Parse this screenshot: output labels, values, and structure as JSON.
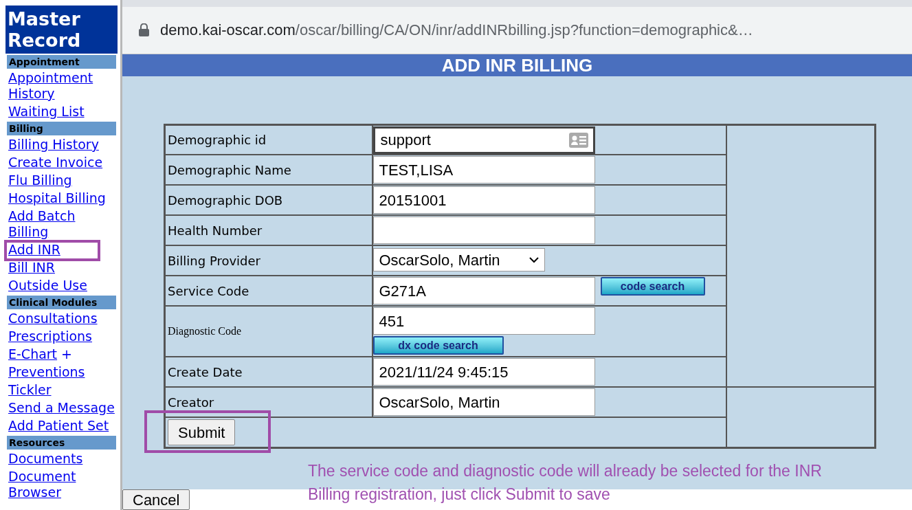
{
  "sidebar": {
    "title": "Master Record",
    "sections": [
      {
        "heading": "Appointment",
        "links": [
          {
            "label": "Appointment History",
            "highlighted": false
          },
          {
            "label": "Waiting List",
            "highlighted": false
          }
        ]
      },
      {
        "heading": "Billing",
        "links": [
          {
            "label": "Billing History",
            "highlighted": false
          },
          {
            "label": "Create Invoice",
            "highlighted": false
          },
          {
            "label": "Flu Billing",
            "highlighted": false
          },
          {
            "label": "Hospital Billing",
            "highlighted": false
          },
          {
            "label": "Add Batch Billing",
            "highlighted": false
          },
          {
            "label": "Add INR",
            "highlighted": true
          },
          {
            "label": "Bill INR",
            "highlighted": false
          },
          {
            "label": "Outside Use",
            "highlighted": false
          }
        ]
      },
      {
        "heading": "Clinical Modules",
        "links": [
          {
            "label": "Consultations",
            "highlighted": false
          },
          {
            "label": "Prescriptions",
            "highlighted": false
          },
          {
            "label": "E-Chart",
            "suffix": "+",
            "highlighted": false
          },
          {
            "label": "Preventions",
            "highlighted": false
          },
          {
            "label": "Tickler",
            "highlighted": false
          },
          {
            "label": "Send a Message",
            "highlighted": false
          },
          {
            "label": "Add Patient Set",
            "highlighted": false
          }
        ]
      },
      {
        "heading": "Resources",
        "links": [
          {
            "label": "Documents",
            "highlighted": false
          },
          {
            "label": "Document Browser",
            "highlighted": false
          }
        ]
      }
    ]
  },
  "browser": {
    "url_host": "demo.kai-oscar.com",
    "url_path": "/oscar/billing/CA/ON/inr/addINRbilling.jsp?function=demographic&…"
  },
  "page_title": "ADD INR BILLING",
  "form": {
    "rows": [
      {
        "kind": "text",
        "label": "Demographic id",
        "value": "support",
        "focused": true
      },
      {
        "kind": "text",
        "label": "Demographic Name",
        "value": "TEST,LISA",
        "focused": false
      },
      {
        "kind": "text",
        "label": "Demographic DOB",
        "value": "20151001",
        "focused": false
      },
      {
        "kind": "text",
        "label": "Health Number",
        "focused": false
      },
      {
        "kind": "select",
        "label": "Billing Provider",
        "value": "OscarSolo, Martin"
      },
      {
        "kind": "search",
        "label": "Service Code",
        "value": "G271A",
        "button": "code search"
      },
      {
        "kind": "diagnostic",
        "label": "Diagnostic Code",
        "value": "451",
        "button": "dx code search"
      },
      {
        "kind": "text",
        "label": "Create Date",
        "value": "2021/11/24 9:45:15",
        "focused": false
      },
      {
        "kind": "text",
        "label": "Creator",
        "value": "OscarSolo, Martin",
        "focused": false
      }
    ],
    "submit": {
      "label": "Submit",
      "highlighted": true
    }
  },
  "annotation": "The service code and diagnostic code will already be selected for the INR Billing registration, just click Submit to save",
  "cancel_button": "Cancel"
}
